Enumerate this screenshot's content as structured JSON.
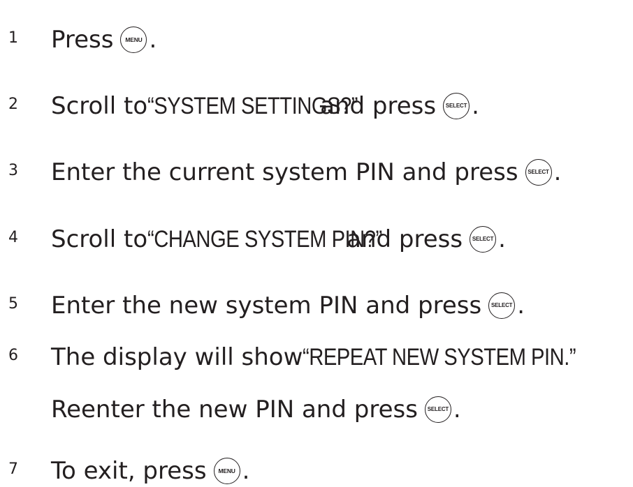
{
  "steps": [
    {
      "number": "1",
      "before": "Press",
      "quoted": "",
      "after": "",
      "button": "MENU",
      "end": "."
    },
    {
      "number": "2",
      "before": "Scroll to ",
      "quoted": "“SYSTEM SETTINGS?”",
      "after": " and press",
      "button": "SELECT",
      "end": "."
    },
    {
      "number": "3",
      "before": "Enter the current system PIN and press",
      "quoted": "",
      "after": "",
      "button": "SELECT",
      "end": "."
    },
    {
      "number": "4",
      "before": "Scroll to ",
      "quoted": "“CHANGE SYSTEM PIN?”",
      "after": " and press",
      "button": "SELECT",
      "end": "."
    },
    {
      "number": "5",
      "before": "Enter the new system PIN and press",
      "quoted": "",
      "after": "",
      "button": "SELECT",
      "end": "."
    },
    {
      "number": "6",
      "before": "The display will show ",
      "quoted": "“REPEAT NEW SYSTEM PIN.”",
      "after": "",
      "button": "",
      "end": ""
    },
    {
      "number": "",
      "before": "Reenter the new PIN and press",
      "quoted": "",
      "after": "",
      "button": "SELECT",
      "end": "."
    },
    {
      "number": "7",
      "before": "To exit, press",
      "quoted": "",
      "after": "",
      "button": "MENU",
      "end": "."
    }
  ]
}
